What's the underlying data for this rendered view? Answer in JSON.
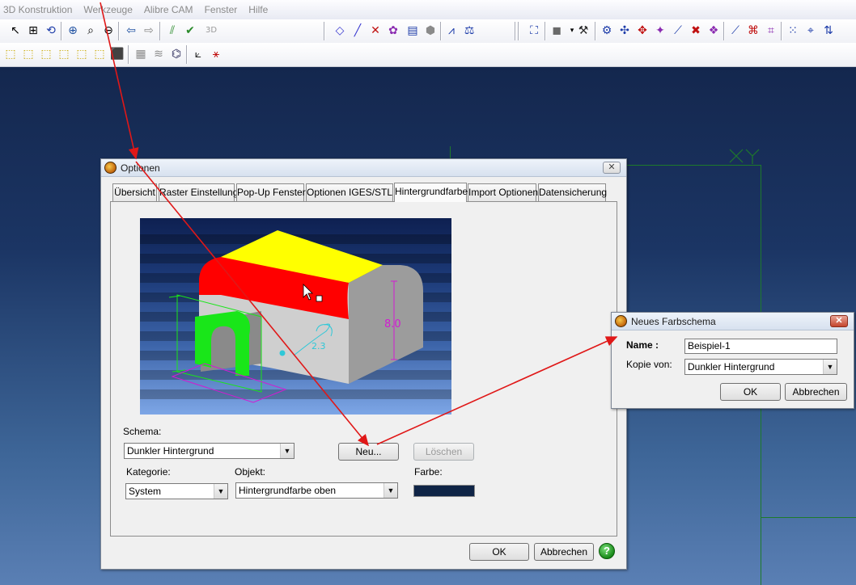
{
  "menubar": {
    "items": [
      "3D Konstruktion",
      "Werkzeuge",
      "Alibre CAM",
      "Fenster",
      "Hilfe"
    ]
  },
  "options_dialog": {
    "title": "Optionen",
    "close_glyph": "✕",
    "tabs": [
      "Übersicht",
      "Raster Einstellung",
      "Pop-Up Fenster",
      "Optionen IGES/STL",
      "Hintergrundfarbe",
      "Import Optionen",
      "Datensicherung"
    ],
    "active_tab": "Hintergrundfarbe",
    "preview": {
      "dimension_label": "8.0",
      "radius_label": "2.3"
    },
    "schema_label": "Schema:",
    "schema_value": "Dunkler Hintergrund",
    "new_button": "Neu...",
    "delete_button": "Löschen",
    "category_label": "Kategorie:",
    "category_value": "System",
    "object_label": "Objekt:",
    "object_value": "Hintergrundfarbe oben",
    "color_label": "Farbe:",
    "color_value": "#0f2446",
    "ok_button": "OK",
    "cancel_button": "Abbrechen",
    "help_glyph": "?"
  },
  "new_scheme_dialog": {
    "title": "Neues Farbschema",
    "close_glyph": "✕",
    "name_label": "Name :",
    "name_value": "Beispiel-1",
    "copy_from_label": "Kopie von:",
    "copy_from_value": "Dunkler Hintergrund",
    "ok_button": "OK",
    "cancel_button": "Abbrechen"
  },
  "colors": {
    "workspace_top": "#14274e",
    "workspace_bottom": "#5a7fb4",
    "grid": "#1e7a2a",
    "annotation_arrow": "#e01818",
    "model_top": "#ffff00",
    "model_red": "#ff0000",
    "model_green": "#19e619",
    "model_gray": "#a8a8a8",
    "dimension_magenta": "#d21bd2",
    "sketch_cyan": "#2ec8d8"
  },
  "icons": {
    "toolbar1": [
      "select-arrow-icon",
      "select-window-icon",
      "lasso-icon",
      "zoom-in-icon",
      "zoom-window-icon",
      "zoom-out-icon",
      "undo-arrow-icon",
      "redo-arrow-icon",
      "mirror-icon",
      "checkmark-tool-icon",
      "3d-icon",
      "diamond-select-icon",
      "line-icon",
      "point-x-icon",
      "purple-blob-icon",
      "layers-icon",
      "hexagon-icon",
      "dimension-icon",
      "scale-icon",
      "render-group-icon",
      "cube-shade-icon",
      "tool-a-icon",
      "tool-b-icon",
      "tool-c-icon",
      "tool-d-icon",
      "tool-e-icon",
      "tool-f-icon",
      "tool-g-icon",
      "tool-h-icon",
      "tool-i-icon",
      "tool-j-icon",
      "tool-k-icon",
      "tool-l-icon",
      "grid-dots-icon",
      "snap-icon",
      "align-icon"
    ],
    "toolbar2": [
      "cube-front-icon",
      "cube-back-icon",
      "cube-left-icon",
      "cube-right-icon",
      "cube-top-icon",
      "cube-bottom-icon",
      "cube-iso-icon",
      "surface-grid-icon",
      "surface-wave-icon",
      "surface-mesh-icon",
      "measure-icon",
      "axis-icon"
    ]
  }
}
